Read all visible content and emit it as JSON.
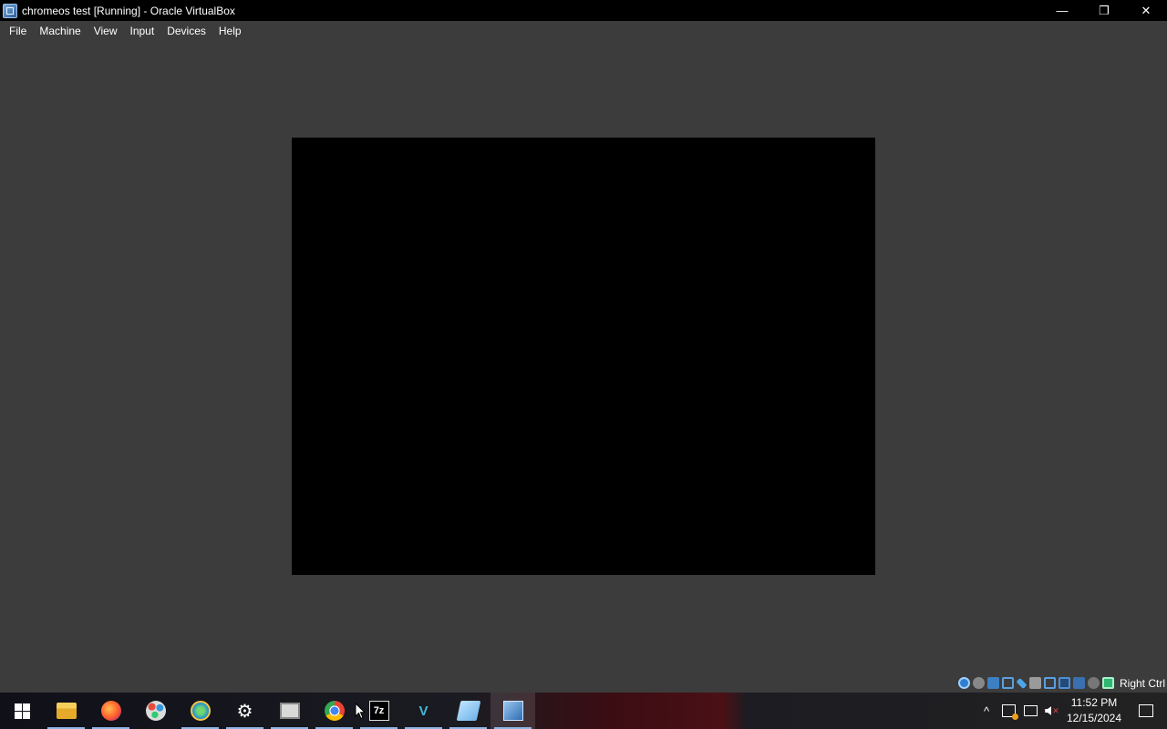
{
  "window": {
    "title": "chromeos test [Running] - Oracle VirtualBox",
    "icon": "virtualbox-icon",
    "controls": {
      "minimize_glyph": "—",
      "restore_glyph": "❐",
      "close_glyph": "✕"
    }
  },
  "menubar": {
    "items": [
      "File",
      "Machine",
      "View",
      "Input",
      "Devices",
      "Help"
    ]
  },
  "statusbar": {
    "icons": [
      "hard-disk-icon",
      "optical-drive-icon",
      "audio-icon",
      "network-icon",
      "usb-icon",
      "shared-folders-icon",
      "display-icon",
      "video-capture-icon",
      "virtualization-icon",
      "mouse-integration-icon",
      "keyboard-icon"
    ],
    "host_key": "Right Ctrl"
  },
  "taskbar": {
    "apps": [
      {
        "name": "file-explorer",
        "icon": "folder-icon",
        "running": true
      },
      {
        "name": "firefox",
        "icon": "firefox-icon",
        "running": true
      },
      {
        "name": "paint",
        "icon": "palette-icon",
        "running": false
      },
      {
        "name": "internet-explorer",
        "icon": "globe-icon",
        "running": true
      },
      {
        "name": "settings",
        "icon": "gear-icon",
        "running": true
      },
      {
        "name": "scanner",
        "icon": "scanner-icon",
        "running": true
      },
      {
        "name": "chrome",
        "icon": "chrome-icon",
        "running": true
      },
      {
        "name": "7zip",
        "icon": "7zip-icon",
        "label": "7z",
        "running": true
      },
      {
        "name": "visual-studio-code",
        "icon": "vs-icon",
        "running": true
      },
      {
        "name": "notepad",
        "icon": "notepad-icon",
        "running": true
      },
      {
        "name": "virtualbox",
        "icon": "virtualbox-icon",
        "running": true,
        "active": true
      }
    ],
    "tray": {
      "chevron_glyph": "^",
      "time": "11:52 PM",
      "date": "12/15/2024"
    }
  }
}
